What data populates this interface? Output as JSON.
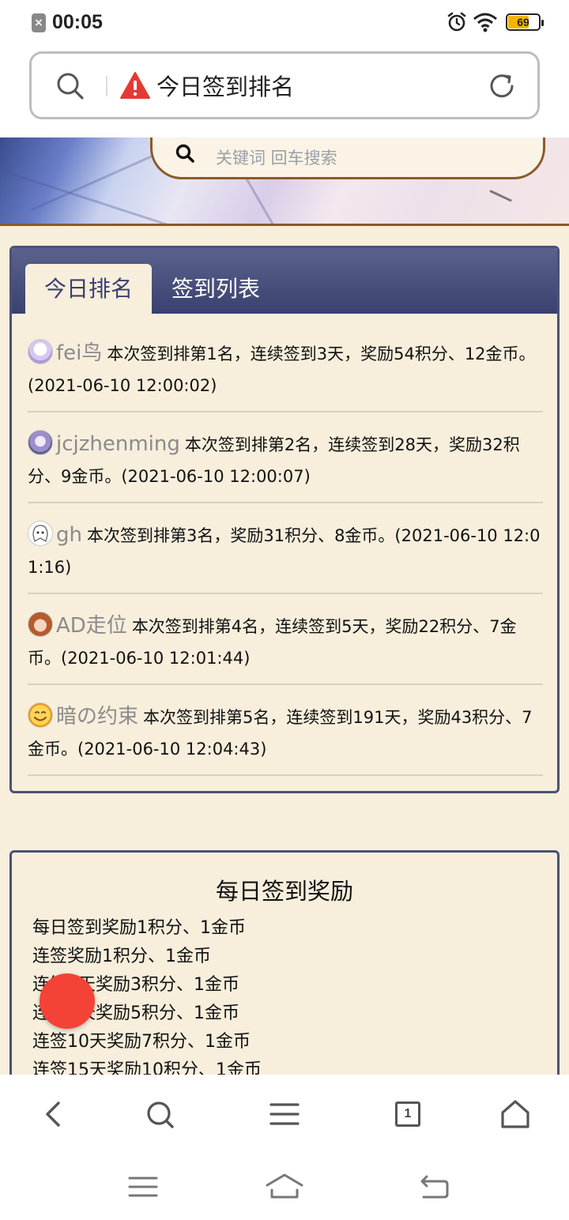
{
  "status_bar": {
    "time": "00:05",
    "battery_level": "69",
    "battery_fraction": 0.69
  },
  "address_bar": {
    "page_title": "今日签到排名",
    "icons": [
      "search-icon",
      "warning-icon",
      "refresh-icon"
    ]
  },
  "site_search": {
    "placeholder": "关键词 回车搜索"
  },
  "ranking_panel": {
    "tabs": [
      {
        "label": "今日排名",
        "active": true
      },
      {
        "label": "签到列表",
        "active": false
      }
    ],
    "entries": [
      {
        "username": "fei鸟",
        "text": "本次签到排第1名，连续签到3天，奖励54积分、12金币。(2021-06-10 12:00:02)"
      },
      {
        "username": "jcjzhenming",
        "text": "本次签到排第2名，连续签到28天，奖励32积分、9金币。(2021-06-10 12:00:07)"
      },
      {
        "username": "gh",
        "text": "本次签到排第3名，奖励31积分、8金币。(2021-06-10 12:01:16)"
      },
      {
        "username": "AD走位",
        "text": "本次签到排第4名，连续签到5天，奖励22积分、7金币。(2021-06-10 12:01:44)"
      },
      {
        "username": "暗の约束",
        "text": "本次签到排第5名，连续签到191天，奖励43积分、7金币。(2021-06-10 12:04:43)"
      }
    ]
  },
  "reward_panel": {
    "title": "每日签到奖励",
    "items": [
      "每日签到奖励1积分、1金币",
      "连签奖励1积分、1金币",
      "连签3天奖励3积分、1金币",
      "连签5天奖励5积分、1金币",
      "连签10天奖励7积分、1金币",
      "连签15天奖励10积分、1金币"
    ]
  },
  "browser_toolbar": {
    "tab_count": "1",
    "icons": [
      "back-icon",
      "search-icon",
      "menu-icon",
      "tabs-icon",
      "home-icon"
    ]
  },
  "system_nav": {
    "icons": [
      "recents-icon",
      "home-icon",
      "back-icon"
    ]
  },
  "colors": {
    "page_bg": "#f7eedc",
    "panel_border": "#4a5275",
    "tab_header": "#3a4170",
    "banner_border": "#8a5a2a",
    "fab": "#f44336",
    "battery": "#f4b400"
  }
}
